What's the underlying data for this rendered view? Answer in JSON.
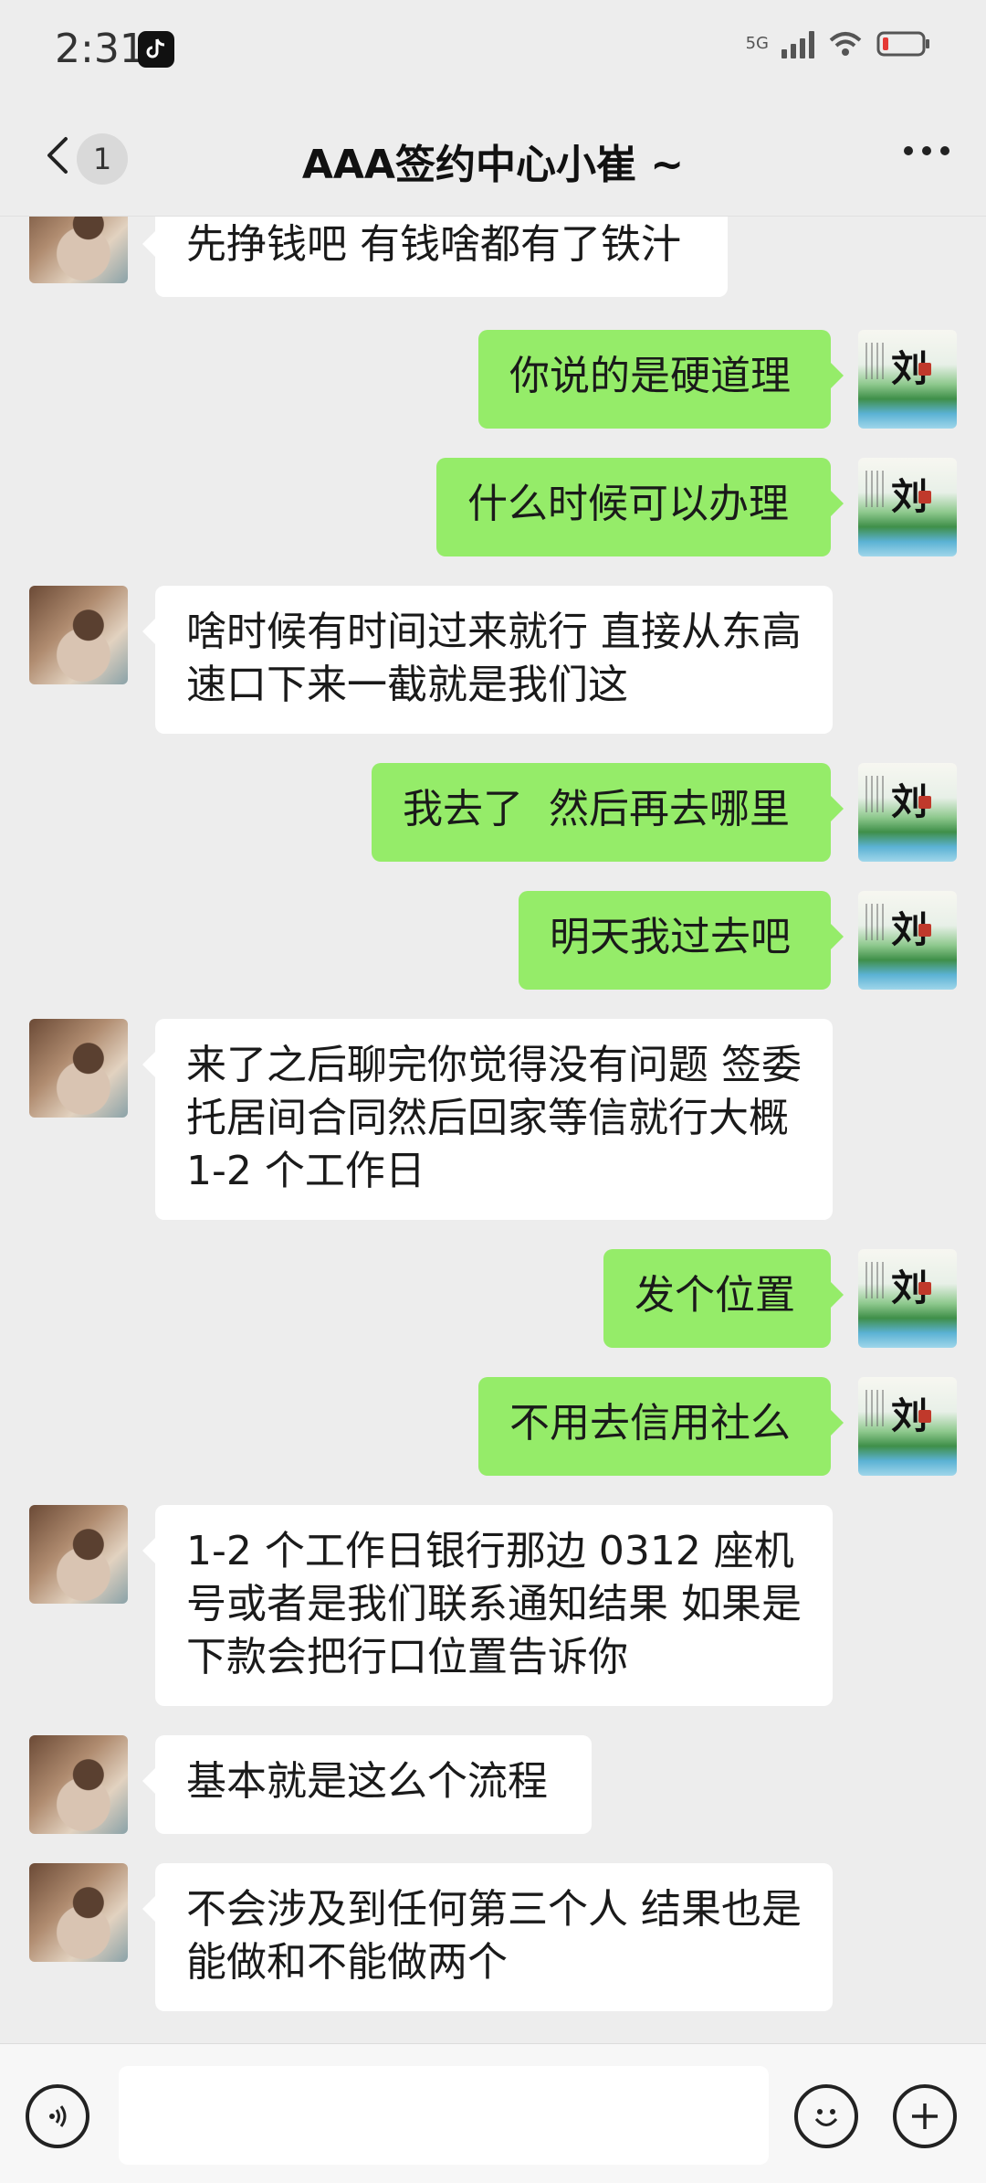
{
  "status_bar": {
    "time": "2:31",
    "network": "5G"
  },
  "header": {
    "unread_count": "1",
    "title": "AAA签约中心小崔 ~"
  },
  "messages": [
    {
      "side": "left",
      "text": "先挣钱吧 有钱啥都有了铁汁"
    },
    {
      "side": "right",
      "text": "你说的是硬道理"
    },
    {
      "side": "right",
      "text": "什么时候可以办理"
    },
    {
      "side": "left",
      "text": "啥时候有时间过来就行 直接从东高速口下来一截就是我们这"
    },
    {
      "side": "right",
      "text": "我去了  然后再去哪里"
    },
    {
      "side": "right",
      "text": "明天我过去吧"
    },
    {
      "side": "left",
      "text": "来了之后聊完你觉得没有问题 签委托居间合同然后回家等信就行大概 1-2 个工作日"
    },
    {
      "side": "right",
      "text": "发个位置"
    },
    {
      "side": "right",
      "text": "不用去信用社么"
    },
    {
      "side": "left",
      "text": "1-2 个工作日银行那边 0312 座机号或者是我们联系通知结果 如果是下款会把行口位置告诉你"
    },
    {
      "side": "left",
      "text": "基本就是这么个流程"
    },
    {
      "side": "left",
      "text": "不会涉及到任何第三个人 结果也是能做和不能做两个"
    }
  ],
  "right_avatar_char": "刘",
  "input": {
    "value": ""
  },
  "colors": {
    "sent_bubble": "#95ec69",
    "received_bubble": "#ffffff",
    "background": "#ededed"
  }
}
